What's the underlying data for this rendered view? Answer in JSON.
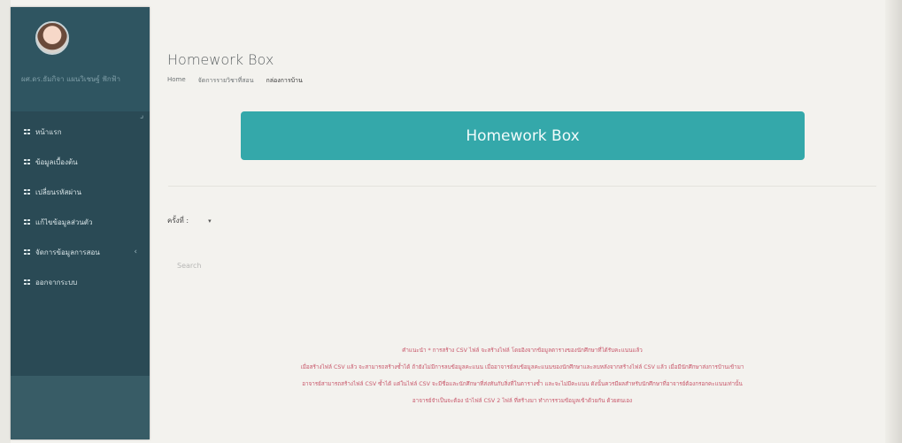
{
  "app": {
    "title": "Homework Box"
  },
  "user": {
    "name": "ผศ.ดร.ธัมกิจา แผนวิเชษฐ์ ฟักฟ้า"
  },
  "sidebar": {
    "items": [
      {
        "label": "หน้าแรก"
      },
      {
        "label": "ข้อมูลเบื้องต้น"
      },
      {
        "label": "เปลี่ยนรหัสผ่าน"
      },
      {
        "label": "แก้ไขข้อมูลส่วนตัว"
      },
      {
        "label": "จัดการข้อมูลการสอน",
        "has_children": true
      },
      {
        "label": "ออกจากระบบ"
      }
    ]
  },
  "breadcrumb": [
    "Home",
    "จัดการรายวิชาที่สอน",
    "กล่องการบ้าน"
  ],
  "hero": {
    "label": "Homework Box"
  },
  "filter": {
    "label": "ครั้งที่ :",
    "value": ""
  },
  "search": {
    "placeholder": "Search"
  },
  "notes": [
    "คำแนะนำ * การสร้าง CSV ไฟล์ จะสร้างไฟล์ โดยอิงจากข้อมูลตารางของนักศึกษาที่ได้รับคะแนนแล้ว",
    "เมื่อสร้างไฟล์ CSV แล้ว จะสามารถสร้างซ้ำได้ ถ้ายังไม่มีการลบข้อมูลคะแนน เมื่ออาจารย์ลบข้อมูลคะแนนของนักศึกษาและลบหลังจากสร้างไฟล์ CSV แล้ว เมื่อมีนักศึกษาส่งการบ้านเข้ามา",
    "อาจารย์สามารถสร้างไฟล์ CSV ซ้ำได้ แต่ในไฟล์ CSV จะมีชื่อและนักศึกษาที่ส่งทันกับสิ่งที่ในตารางซ้ำ และจะไม่มีคะแนน ดังนั้นควรมีผลสำหรับนักศึกษาที่อาจารย์ต้องกรอกคะแนนเท่านั้น",
    "อาจารย์จำเป็นจะต้อง นำไฟล์ CSV 2 ไฟล์ ที่สร้างมา ทำการรวมข้อมูลเข้าด้วยกัน ด้วยตนเอง"
  ],
  "colors": {
    "sidebar_bg": "#2a4a55",
    "hero_bg": "#34a8aa",
    "note_text": "#c8576a"
  },
  "icons": {
    "menu_item": "grid-icon",
    "submenu": "chevron-left-icon",
    "select": "caret-down-icon"
  }
}
